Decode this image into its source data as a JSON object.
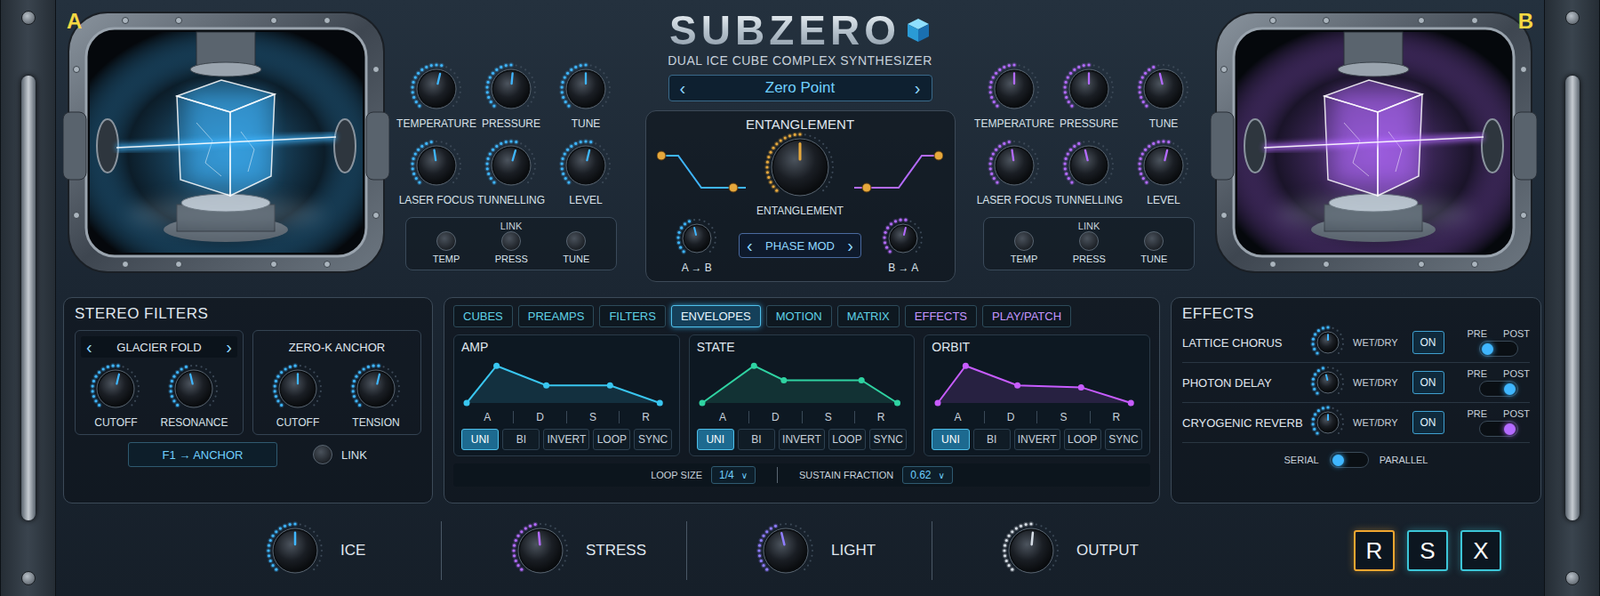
{
  "title": "SUBZERO",
  "subtitle": "DUAL ICE CUBE COMPLEX SYNTHESIZER",
  "cubes": [
    {
      "badge": "A",
      "color": "#3fb6ff",
      "knobs": [
        {
          "label": "TEMPERATURE",
          "level": 0.55
        },
        {
          "label": "PRESSURE",
          "level": 0.52
        },
        {
          "label": "TUNE",
          "level": 0.5
        },
        {
          "label": "LASER FOCUS",
          "level": 0.47
        },
        {
          "label": "TUNNELLING",
          "level": 0.56
        },
        {
          "label": "LEVEL",
          "level": 0.55
        }
      ],
      "link": {
        "label": "LINK",
        "buttons": [
          {
            "label": "TEMP",
            "on": false
          },
          {
            "label": "PRESS",
            "on": false
          },
          {
            "label": "TUNE",
            "on": false
          }
        ]
      }
    },
    {
      "badge": "B",
      "color": "#b46bff",
      "knobs": [
        {
          "label": "TEMPERATURE",
          "level": 0.5
        },
        {
          "label": "PRESSURE",
          "level": 0.5
        },
        {
          "label": "TUNE",
          "level": 0.45
        },
        {
          "label": "LASER FOCUS",
          "level": 0.47
        },
        {
          "label": "TUNNELLING",
          "level": 0.45
        },
        {
          "label": "LEVEL",
          "level": 0.55
        }
      ],
      "link": {
        "label": "LINK",
        "buttons": [
          {
            "label": "TEMP",
            "on": false
          },
          {
            "label": "PRESS",
            "on": false
          },
          {
            "label": "TUNE",
            "on": false
          }
        ]
      }
    }
  ],
  "preset": {
    "prev": "‹",
    "name": "Zero Point",
    "next": "›"
  },
  "entanglement": {
    "title": "ENTANGLEMENT",
    "main": {
      "label": "ENTANGLEMENT",
      "level": 0.5
    },
    "a_to_b": {
      "label": "A → B",
      "level": 0.45
    },
    "b_to_a": {
      "label": "B → A",
      "level": 0.55
    },
    "mode": {
      "prev": "‹",
      "name": "PHASE MOD",
      "next": "›"
    }
  },
  "filters": {
    "title": "STEREO FILTERS",
    "filter1": {
      "prev": "‹",
      "name": "GLACIER FOLD",
      "next": "›",
      "knobs": [
        {
          "label": "CUTOFF",
          "level": 0.55
        },
        {
          "label": "RESONANCE",
          "level": 0.45
        }
      ]
    },
    "filter2": {
      "name": "ZERO-K ANCHOR",
      "knobs": [
        {
          "label": "CUTOFF",
          "level": 0.5
        },
        {
          "label": "TENSION",
          "level": 0.55
        }
      ]
    },
    "routing": "F1 → ANCHOR",
    "link": {
      "label": "LINK",
      "on": false
    }
  },
  "tabs": [
    {
      "label": "CUBES",
      "selected": false,
      "color": "#5fd2e6"
    },
    {
      "label": "PREAMPS",
      "selected": false,
      "color": "#5fd2e6"
    },
    {
      "label": "FILTERS",
      "selected": false,
      "color": "#5fd2e6"
    },
    {
      "label": "ENVELOPES",
      "selected": true,
      "color": "#e8f6ff"
    },
    {
      "label": "MOTION",
      "selected": false,
      "color": "#5fd2e6"
    },
    {
      "label": "MATRIX",
      "selected": false,
      "color": "#5fd2e6"
    },
    {
      "label": "EFFECTS",
      "selected": false,
      "color": "#c496ff"
    },
    {
      "label": "PLAY/PATCH",
      "selected": false,
      "color": "#c496ff"
    }
  ],
  "envelopes": [
    {
      "name": "AMP",
      "color": "#39c6f0",
      "points": [
        [
          0,
          0
        ],
        [
          0.15,
          0.95
        ],
        [
          0.4,
          0.45
        ],
        [
          0.72,
          0.45
        ],
        [
          0.97,
          0
        ]
      ],
      "stages": [
        "A",
        "D",
        "S",
        "R"
      ],
      "modes": [
        {
          "label": "UNI",
          "selected": true
        },
        {
          "label": "BI",
          "selected": false
        },
        {
          "label": "INVERT",
          "selected": false
        },
        {
          "label": "LOOP",
          "selected": false
        },
        {
          "label": "SYNC",
          "selected": false
        }
      ]
    },
    {
      "name": "STATE",
      "color": "#2fd3a2",
      "points": [
        [
          0,
          0
        ],
        [
          0.26,
          0.95
        ],
        [
          0.41,
          0.58
        ],
        [
          0.8,
          0.58
        ],
        [
          0.98,
          0
        ]
      ],
      "stages": [
        "A",
        "D",
        "S",
        "R"
      ],
      "modes": [
        {
          "label": "UNI",
          "selected": true
        },
        {
          "label": "BI",
          "selected": false
        },
        {
          "label": "INVERT",
          "selected": false
        },
        {
          "label": "LOOP",
          "selected": false
        },
        {
          "label": "SYNC",
          "selected": false
        }
      ]
    },
    {
      "name": "ORBIT",
      "color": "#c75cff",
      "points": [
        [
          0,
          0
        ],
        [
          0.14,
          0.95
        ],
        [
          0.4,
          0.45
        ],
        [
          0.72,
          0.4
        ],
        [
          0.97,
          0
        ]
      ],
      "stages": [
        "A",
        "D",
        "S",
        "R"
      ],
      "modes": [
        {
          "label": "UNI",
          "selected": true
        },
        {
          "label": "BI",
          "selected": false
        },
        {
          "label": "INVERT",
          "selected": false
        },
        {
          "label": "LOOP",
          "selected": false
        },
        {
          "label": "SYNC",
          "selected": false
        }
      ]
    }
  ],
  "loop_size": {
    "label": "LOOP SIZE",
    "value": "1/4",
    "arrow": "∨"
  },
  "sustain_fraction": {
    "label": "SUSTAIN FRACTION",
    "value": "0.62",
    "arrow": "∨"
  },
  "effects": {
    "title": "EFFECTS",
    "items": [
      {
        "name": "LATTICE CHORUS",
        "mix_label": "WET/DRY",
        "level": 0.5,
        "on_label": "ON",
        "on": true,
        "pre_label": "PRE",
        "post_label": "POST",
        "post": false,
        "color": "#3fb6ff"
      },
      {
        "name": "PHOTON DELAY",
        "mix_label": "WET/DRY",
        "level": 0.45,
        "on_label": "ON",
        "on": true,
        "pre_label": "PRE",
        "post_label": "POST",
        "post": true,
        "color": "#3fb6ff"
      },
      {
        "name": "CRYOGENIC REVERB",
        "mix_label": "WET/DRY",
        "level": 0.5,
        "on_label": "ON",
        "on": true,
        "pre_label": "PRE",
        "post_label": "POST",
        "post": true,
        "color": "#b46bff"
      }
    ],
    "routing": {
      "left": "SERIAL",
      "right": "PARALLEL",
      "parallel": false
    }
  },
  "macros": [
    {
      "label": "ICE",
      "level": 0.5,
      "color": "#3fb6ff"
    },
    {
      "label": "STRESS",
      "level": 0.48,
      "color": "#b46bff"
    },
    {
      "label": "LIGHT",
      "level": 0.45,
      "color": "#8f7dff"
    },
    {
      "label": "OUTPUT",
      "level": 0.52,
      "color": "#d6dde5"
    }
  ],
  "buttons": [
    {
      "label": "R",
      "color": "#f0a630"
    },
    {
      "label": "S",
      "color": "#3cc6d8"
    },
    {
      "label": "X",
      "color": "#3cc6d8"
    }
  ]
}
